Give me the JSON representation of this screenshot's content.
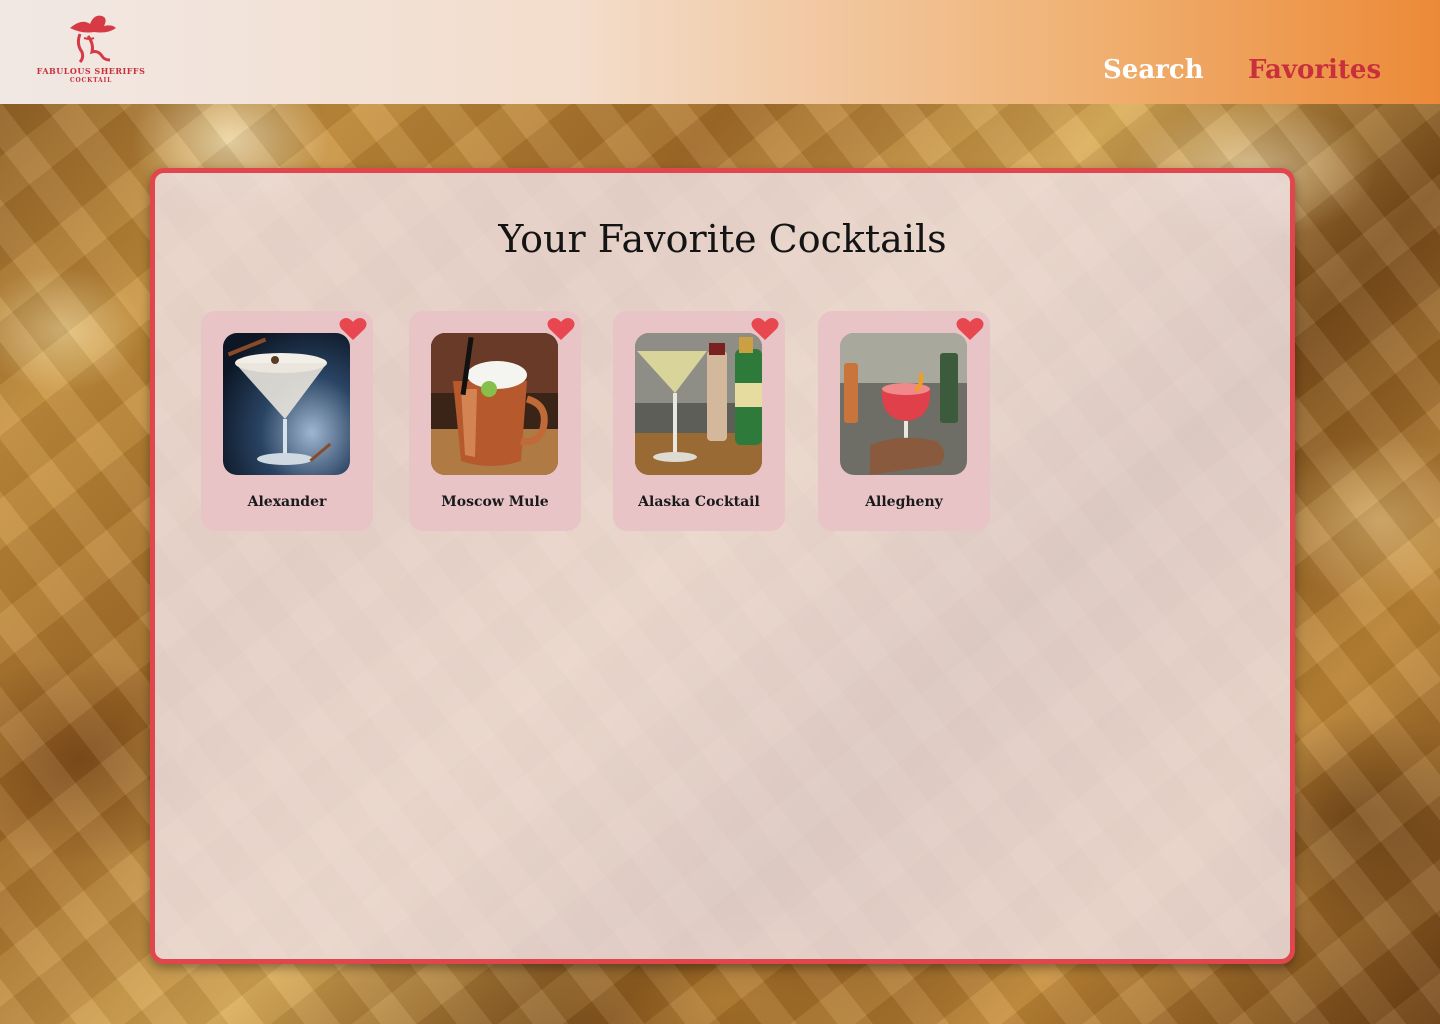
{
  "brand": {
    "line1": "FABULOUS SHERIFFS",
    "line2": "COCKTAIL",
    "color": "#c8303c"
  },
  "nav": {
    "search_label": "Search",
    "favorites_label": "Favorites",
    "active": "favorites"
  },
  "main": {
    "title": "Your Favorite Cocktails"
  },
  "favorites": [
    {
      "name": "Alexander",
      "favorited": true,
      "icon": "heart-icon"
    },
    {
      "name": "Moscow Mule",
      "favorited": true,
      "icon": "heart-icon"
    },
    {
      "name": "Alaska Cocktail",
      "favorited": true,
      "icon": "heart-icon"
    },
    {
      "name": "Allegheny",
      "favorited": true,
      "icon": "heart-icon"
    }
  ],
  "colors": {
    "accent": "#e2464d",
    "heart": "#e8474f",
    "card": "#e8c4c7"
  }
}
